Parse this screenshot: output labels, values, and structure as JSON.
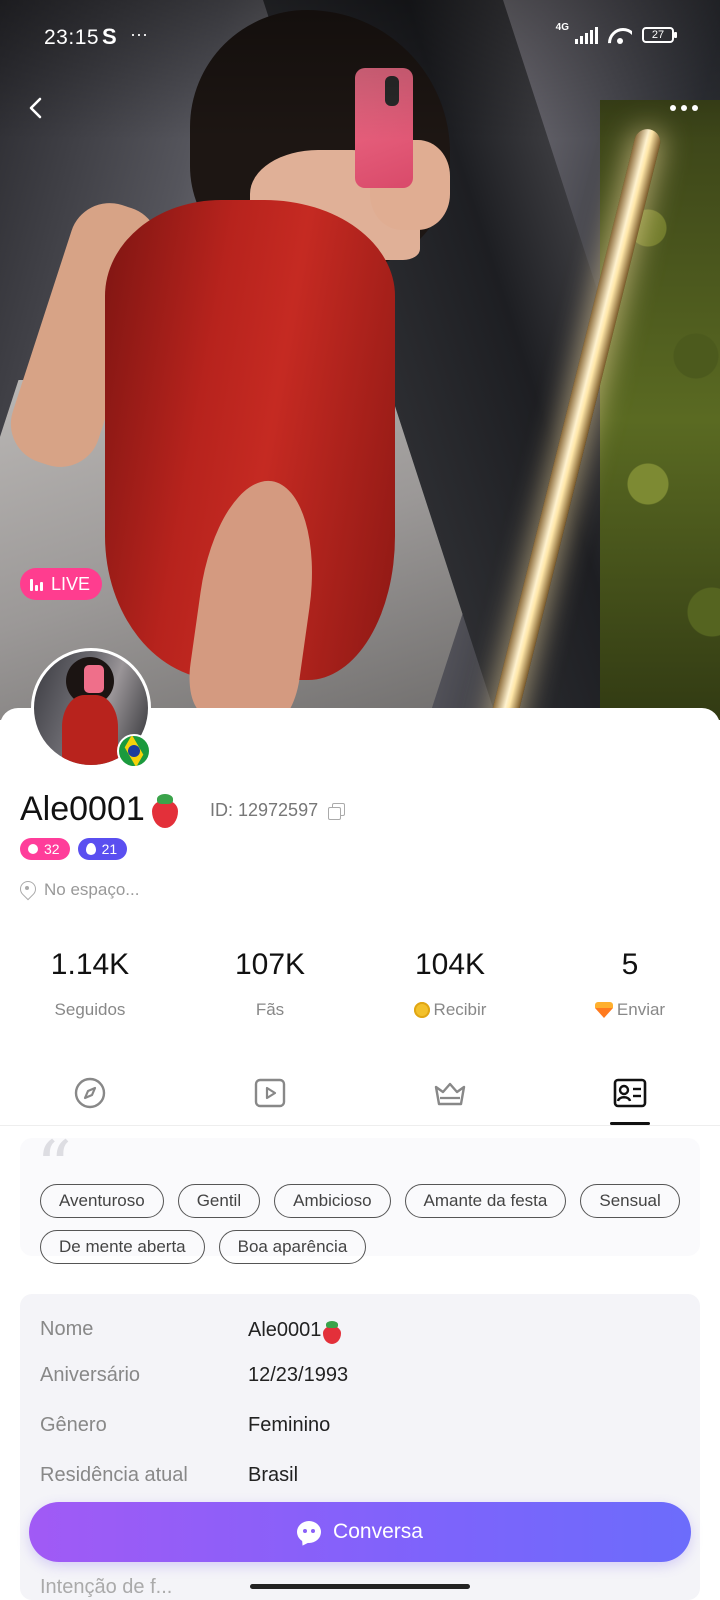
{
  "status_bar": {
    "time": "23:15",
    "carrier_glyph": "S",
    "dots": "···",
    "network": "4G",
    "battery": "27"
  },
  "header": {
    "back_icon": "chevron-left-icon",
    "more_icon": "more-horizontal-icon"
  },
  "live_badge": {
    "label": "LIVE",
    "color": "#ff3d8f"
  },
  "profile": {
    "username": "Ale0001",
    "username_emoji": "strawberry",
    "id_text": "ID: 12972597",
    "country_flag": "Brazil",
    "levels": [
      {
        "value": "32",
        "color": "#ff3d9a",
        "icon": "level-icon"
      },
      {
        "value": "21",
        "color": "#5a4ff0",
        "icon": "drop-icon"
      }
    ],
    "location": "No espaço..."
  },
  "stats": [
    {
      "value": "1.14K",
      "label": "Seguidos"
    },
    {
      "value": "107K",
      "label": "Fãs"
    },
    {
      "value": "104K",
      "label": "Recibir",
      "icon": "coin-icon"
    },
    {
      "value": "5",
      "label": "Enviar",
      "icon": "gem-icon"
    }
  ],
  "tabs": [
    {
      "icon": "compass-icon",
      "active": false
    },
    {
      "icon": "video-play-icon",
      "active": false
    },
    {
      "icon": "crown-icon",
      "active": false
    },
    {
      "icon": "profile-card-icon",
      "active": true
    }
  ],
  "tags": [
    "Aventuroso",
    "Gentil",
    "Ambicioso",
    "Amante da festa",
    "Sensual",
    "De mente aberta",
    "Boa aparência"
  ],
  "info": [
    {
      "key": "Nome",
      "value": "Ale0001"
    },
    {
      "key": "Aniversário",
      "value": "12/23/1993"
    },
    {
      "key": "Gênero",
      "value": "Feminino"
    },
    {
      "key": "Residência atual",
      "value": "Brasil"
    }
  ],
  "info_cut_text": "Intenção de f...",
  "chat_button": {
    "label": "Conversa",
    "gradient_start": "#a15af5",
    "gradient_end": "#6c6cfb"
  }
}
